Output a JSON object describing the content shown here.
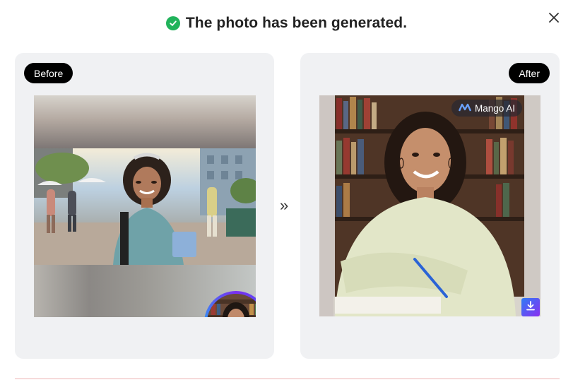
{
  "header": {
    "title": "The photo has been generated."
  },
  "panels": {
    "before_label": "Before",
    "after_label": "After",
    "arrow": "»",
    "watermark": "Mango AI"
  },
  "colors": {
    "success": "#21b35b",
    "accent_gradient": [
      "#2e7cf6",
      "#8a2ff0"
    ]
  },
  "icons": [
    "check-circle-icon",
    "close-icon",
    "double-chevron-right-icon",
    "mango-ai-logo-icon",
    "download-icon"
  ]
}
